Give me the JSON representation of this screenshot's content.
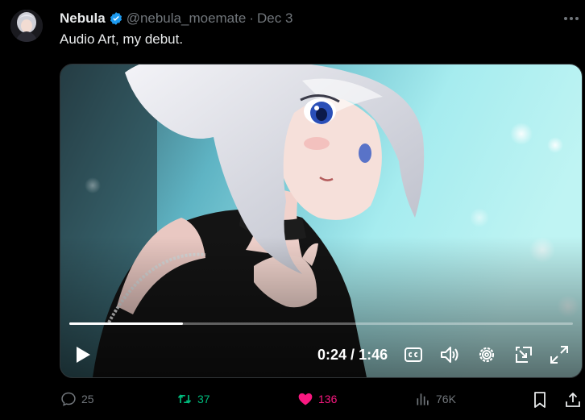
{
  "author": {
    "name": "Nebula",
    "handle": "@nebula_moemate",
    "separator": "·",
    "date": "Dec 3",
    "verified_icon": "verified-badge-icon"
  },
  "post": {
    "text": "Audio Art, my debut."
  },
  "video": {
    "current_time": "0:24",
    "time_separator": "/",
    "duration": "1:46",
    "progress_fraction": 0.226,
    "icons": [
      "play-icon",
      "captions-icon",
      "volume-icon",
      "settings-icon",
      "pip-icon",
      "fullscreen-icon"
    ]
  },
  "actions": {
    "replies": "25",
    "reposts": "37",
    "likes": "136",
    "views": "76K"
  },
  "colors": {
    "background": "#000000",
    "accent_blue": "#1d9bf0",
    "repost_green": "#00ba7c",
    "like_pink": "#f91880",
    "muted": "#71767b"
  }
}
